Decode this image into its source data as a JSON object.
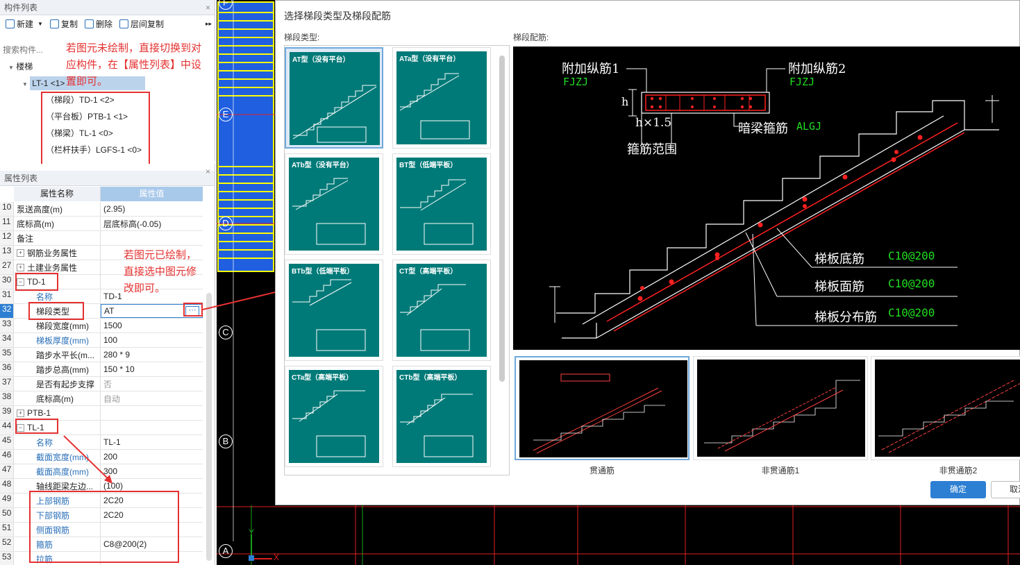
{
  "component_panel": {
    "title": "构件列表",
    "close": "×",
    "toolbar": {
      "new": "新建",
      "copy": "复制",
      "delete": "删除",
      "floor_copy": "层间复制",
      "more": "▸▸"
    },
    "search_placeholder": "搜索构件...",
    "tree": {
      "root": "楼梯",
      "item": "LT-1 <1>",
      "children": [
        "（梯段）TD-1 <2>",
        "（平台板）PTB-1 <1>",
        "（梯梁）TL-1 <0>",
        "（栏杆扶手）LGFS-1 <0>"
      ]
    },
    "note_top": [
      "若图元未绘制，直接切换到对",
      "应构件，在【属性列表】中设",
      "置即可。"
    ]
  },
  "property_panel": {
    "title": "属性列表",
    "close": "×",
    "col_name": "属性名称",
    "col_value": "属性值",
    "note_mid": [
      "若图元已绘制，",
      "直接选中图元修",
      "改即可。"
    ],
    "rows": [
      {
        "num": "10",
        "name": "泵送高度(m)",
        "value": "(2.95)"
      },
      {
        "num": "11",
        "name": "底标高(m)",
        "value": "层底标高(-0.05)"
      },
      {
        "num": "12",
        "name": "备注",
        "value": ""
      },
      {
        "num": "13",
        "name": "钢筋业务属性",
        "value": "",
        "exp": "+"
      },
      {
        "num": "27",
        "name": "土建业务属性",
        "value": "",
        "exp": "+"
      },
      {
        "num": "30",
        "name": "TD-1",
        "value": "",
        "exp": "−"
      },
      {
        "num": "31",
        "name": "名称",
        "value": "TD-1"
      },
      {
        "num": "32",
        "name": "梯段类型",
        "value": "AT"
      },
      {
        "num": "33",
        "name": "梯段宽度(mm)",
        "value": "1500"
      },
      {
        "num": "34",
        "name": "梯板厚度(mm)",
        "value": "100"
      },
      {
        "num": "35",
        "name": "踏步水平长(m...",
        "value": "280 * 9"
      },
      {
        "num": "36",
        "name": "踏步总高(mm)",
        "value": "150 * 10"
      },
      {
        "num": "37",
        "name": "是否有起步支撑",
        "value": "否"
      },
      {
        "num": "38",
        "name": "底标高(m)",
        "value": "自动"
      },
      {
        "num": "39",
        "name": "PTB-1",
        "value": "",
        "exp": "+"
      },
      {
        "num": "44",
        "name": "TL-1",
        "value": "",
        "exp": "−"
      },
      {
        "num": "45",
        "name": "名称",
        "value": "TL-1"
      },
      {
        "num": "46",
        "name": "截面宽度(mm)",
        "value": "200"
      },
      {
        "num": "47",
        "name": "截面高度(mm)",
        "value": "300"
      },
      {
        "num": "48",
        "name": "轴线距梁左边...",
        "value": "(100)"
      },
      {
        "num": "49",
        "name": "上部钢筋",
        "value": "2C20"
      },
      {
        "num": "50",
        "name": "下部钢筋",
        "value": "2C20"
      },
      {
        "num": "51",
        "name": "侧面钢筋",
        "value": ""
      },
      {
        "num": "52",
        "name": "箍筋",
        "value": "C8@200(2)"
      },
      {
        "num": "53",
        "name": "拉筋",
        "value": ""
      }
    ]
  },
  "canvas": {
    "axis_labels": [
      "F",
      "E",
      "D",
      "C",
      "B",
      "A"
    ],
    "x_axis": "X",
    "y_axis": "Y"
  },
  "dialog": {
    "title": "选择梯段类型及梯段配筋",
    "type_label": "梯段类型:",
    "rebar_label": "梯段配筋:",
    "types": [
      "AT型（没有平台）",
      "ATa型（没有平台）",
      "ATb型（没有平台）",
      "BT型（低端平板）",
      "BTb型（低端平板）",
      "CT型（高端平板）",
      "CTa型（高端平板）",
      "CTb型（高端平板）"
    ],
    "detail": {
      "fjzj1": "附加纵筋1",
      "fjzj1_code": "FJZJ",
      "fjzj2": "附加纵筋2",
      "fjzj2_code": "FJZJ",
      "h": "h",
      "h_times": "h×1.5",
      "stirrup_range": "箍筋范围",
      "algj": "暗梁箍筋",
      "algj_code": "ALGJ",
      "bottom": "梯板底筋",
      "bottom_val": "C10@200",
      "top": "梯板面筋",
      "top_val": "C10@200",
      "dist": "梯板分布筋",
      "dist_val": "C10@200"
    },
    "thumbs": [
      "贯通筋",
      "非贯通筋1",
      "非贯通筋2"
    ],
    "ok": "确定",
    "cancel": "取消"
  },
  "colors": {
    "accent": "#2d7fd3",
    "red": "#e53030",
    "teal": "#007a78",
    "green_label": "#22dd22"
  }
}
